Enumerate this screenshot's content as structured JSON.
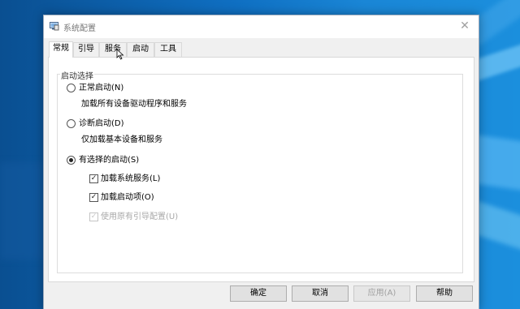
{
  "window": {
    "title": "系统配置",
    "close_glyph": "✕"
  },
  "tabs": [
    {
      "label": "常规",
      "active": true
    },
    {
      "label": "引导",
      "active": false
    },
    {
      "label": "服务",
      "active": false
    },
    {
      "label": "启动",
      "active": false
    },
    {
      "label": "工具",
      "active": false
    }
  ],
  "startup_selection": {
    "legend": "启动选择",
    "options": [
      {
        "label": "正常启动(N)",
        "description": "加载所有设备驱动程序和服务",
        "selected": false
      },
      {
        "label": "诊断启动(D)",
        "description": "仅加载基本设备和服务",
        "selected": false
      },
      {
        "label": "有选择的启动(S)",
        "description": "",
        "selected": true
      }
    ],
    "checkboxes": [
      {
        "label": "加载系统服务(L)",
        "checked": true,
        "enabled": true
      },
      {
        "label": "加载启动项(O)",
        "checked": true,
        "enabled": true
      },
      {
        "label": "使用原有引导配置(U)",
        "checked": true,
        "enabled": false
      }
    ]
  },
  "buttons": {
    "ok": "确定",
    "cancel": "取消",
    "apply": "应用(A)",
    "help": "帮助"
  },
  "icons": {
    "app": "msconfig-icon",
    "close": "close-icon",
    "cursor": "mouse-cursor-icon"
  },
  "colors": {
    "desktop": "#0f6fc2",
    "dialog": "#f0f0f0",
    "panel": "#ffffff",
    "button": "#e1e1e1"
  }
}
